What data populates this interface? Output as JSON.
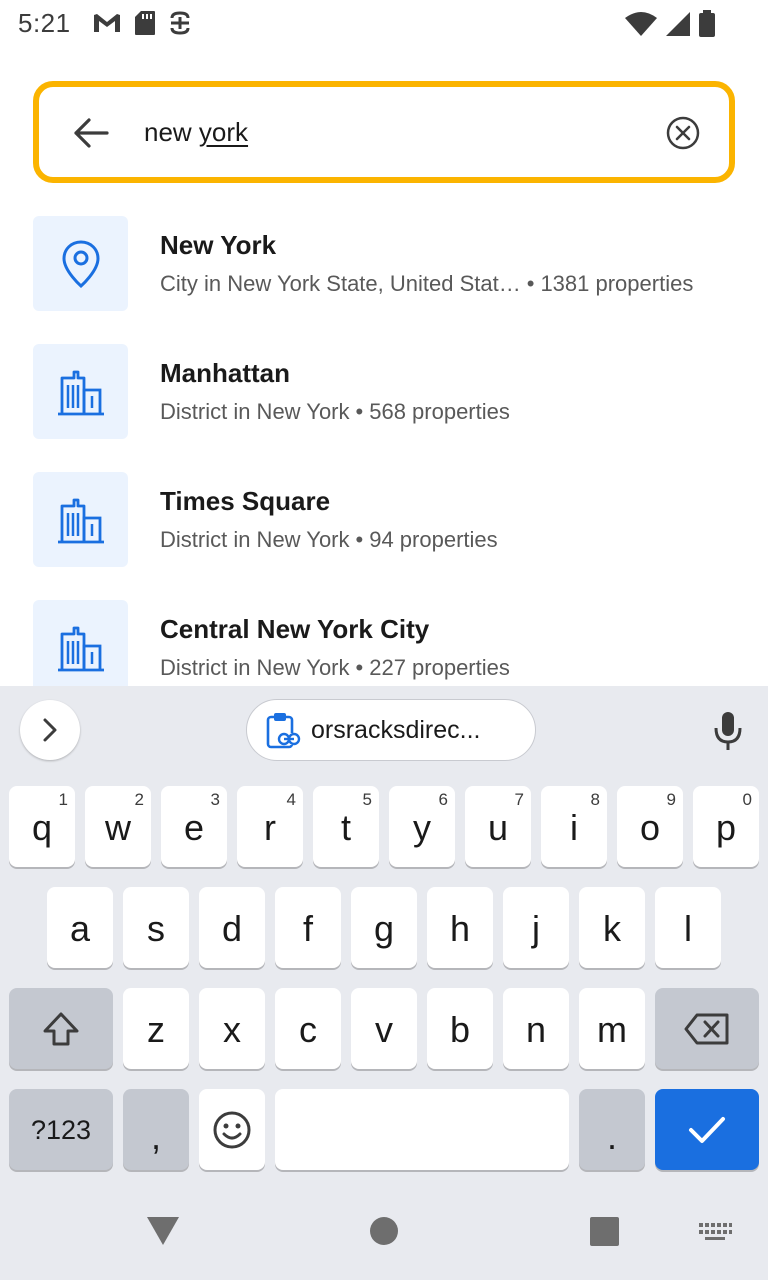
{
  "status_bar": {
    "time": "5:21",
    "left_icons": [
      "gmail-icon",
      "sd-card-icon",
      "sync-icon"
    ],
    "right_icons": [
      "wifi-icon",
      "cell-signal-icon",
      "battery-icon"
    ]
  },
  "search": {
    "query_plain": "new ",
    "query_underlined": "york",
    "accent_color": "#fbb400"
  },
  "results": [
    {
      "icon": "location-pin-icon",
      "title": "New York",
      "description": "City in New York State, United Stat…",
      "separator": "•",
      "count": "1381 properties"
    },
    {
      "icon": "buildings-icon",
      "title": "Manhattan",
      "description": "District in New York",
      "separator": "•",
      "count": "568 properties"
    },
    {
      "icon": "buildings-icon",
      "title": "Times Square",
      "description": "District in New York",
      "separator": "•",
      "count": "94 properties"
    },
    {
      "icon": "buildings-icon",
      "title": "Central New York City",
      "description": "District in New York",
      "separator": "•",
      "count": "227 properties"
    }
  ],
  "keyboard": {
    "clipboard_chip": "orsracksdirec...",
    "row1": [
      {
        "key": "q",
        "hint": "1"
      },
      {
        "key": "w",
        "hint": "2"
      },
      {
        "key": "e",
        "hint": "3"
      },
      {
        "key": "r",
        "hint": "4"
      },
      {
        "key": "t",
        "hint": "5"
      },
      {
        "key": "y",
        "hint": "6"
      },
      {
        "key": "u",
        "hint": "7"
      },
      {
        "key": "i",
        "hint": "8"
      },
      {
        "key": "o",
        "hint": "9"
      },
      {
        "key": "p",
        "hint": "0"
      }
    ],
    "row2": [
      "a",
      "s",
      "d",
      "f",
      "g",
      "h",
      "j",
      "k",
      "l"
    ],
    "row3": [
      "z",
      "x",
      "c",
      "v",
      "b",
      "n",
      "m"
    ],
    "symbols_label": "?123",
    "comma_label": ",",
    "period_label": ".",
    "action_color": "#1a6fe0"
  }
}
